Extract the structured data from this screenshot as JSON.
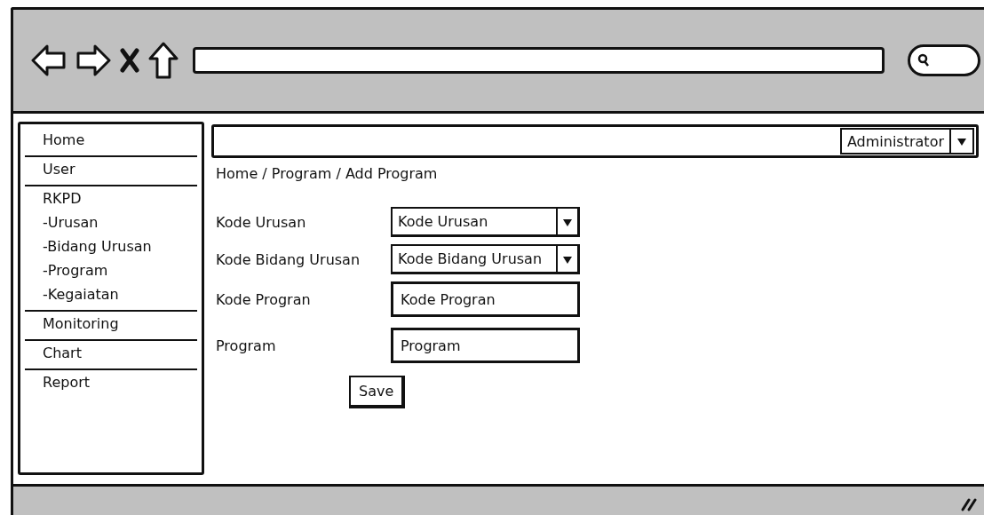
{
  "sidebar": {
    "items": [
      {
        "label": "Home"
      },
      {
        "label": "User"
      },
      {
        "label": "RKPD",
        "children": [
          {
            "label": "-Urusan"
          },
          {
            "label": "-Bidang Urusan"
          },
          {
            "label": "-Program"
          },
          {
            "label": "-Kegaiatan"
          }
        ]
      },
      {
        "label": "Monitoring"
      },
      {
        "label": "Chart"
      },
      {
        "label": "Report"
      }
    ]
  },
  "header": {
    "user_menu": "Administrator"
  },
  "breadcrumb": "Home / Program / Add Program",
  "form": {
    "fields": [
      {
        "kind": "dropdown",
        "label": "Kode Urusan",
        "value": "Kode Urusan"
      },
      {
        "kind": "dropdown",
        "label": "Kode Bidang Urusan",
        "value": "Kode Bidang Urusan"
      },
      {
        "kind": "text",
        "label": "Kode Progran",
        "value": "Kode Progran"
      },
      {
        "kind": "text",
        "label": "Program",
        "value": "Program"
      }
    ],
    "submit": "Save"
  }
}
